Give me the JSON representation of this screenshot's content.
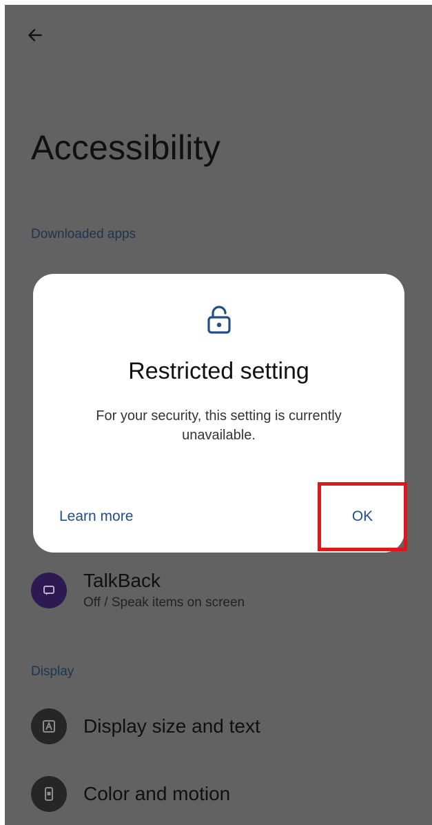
{
  "page": {
    "title": "Accessibility"
  },
  "sections": {
    "downloaded_apps": "Downloaded apps",
    "display": "Display"
  },
  "items": {
    "talkback": {
      "title": "TalkBack",
      "subtitle": "Off / Speak items on screen"
    },
    "display_size": {
      "title": "Display size and text"
    },
    "color_motion": {
      "title": "Color and motion"
    }
  },
  "dialog": {
    "icon": "lock-icon",
    "title": "Restricted setting",
    "body": "For your security, this setting is currently unavailable.",
    "learn_more": "Learn more",
    "ok": "OK"
  },
  "colors": {
    "scrim_background": "#626262",
    "accent_text": "#1f4e8a",
    "highlight_box": "#e0161c"
  }
}
